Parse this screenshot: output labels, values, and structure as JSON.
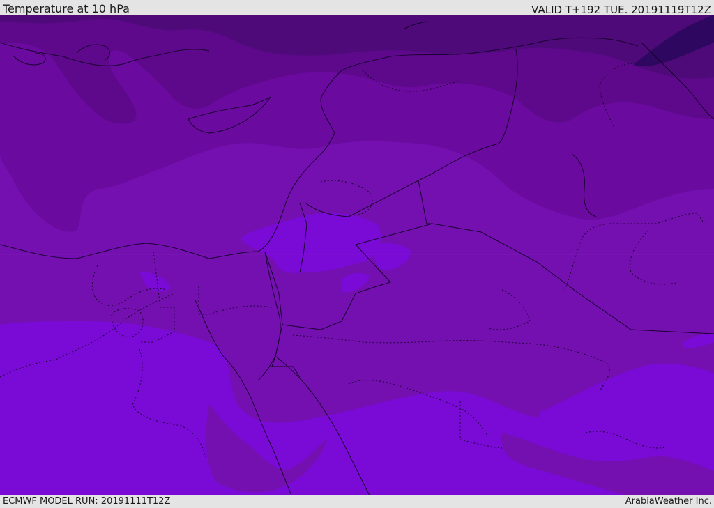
{
  "header": {
    "title": "Temperature at 10 hPa",
    "valid": "VALID T+192 TUE. 20191119T12Z"
  },
  "footer": {
    "model_run": "ECMWF MODEL RUN: 20191111T12Z",
    "credit": "ArabiaWeather Inc."
  },
  "map": {
    "field": "temperature",
    "pressure_level": "10 hPa",
    "palette": [
      "#2e0760",
      "#4f0a7a",
      "#5e098c",
      "#6a0a9e",
      "#7410b0",
      "#7a0ad6",
      "#8a10f0"
    ],
    "lines": {
      "coast_color": "#1a0030",
      "border_style": "dotted"
    }
  }
}
